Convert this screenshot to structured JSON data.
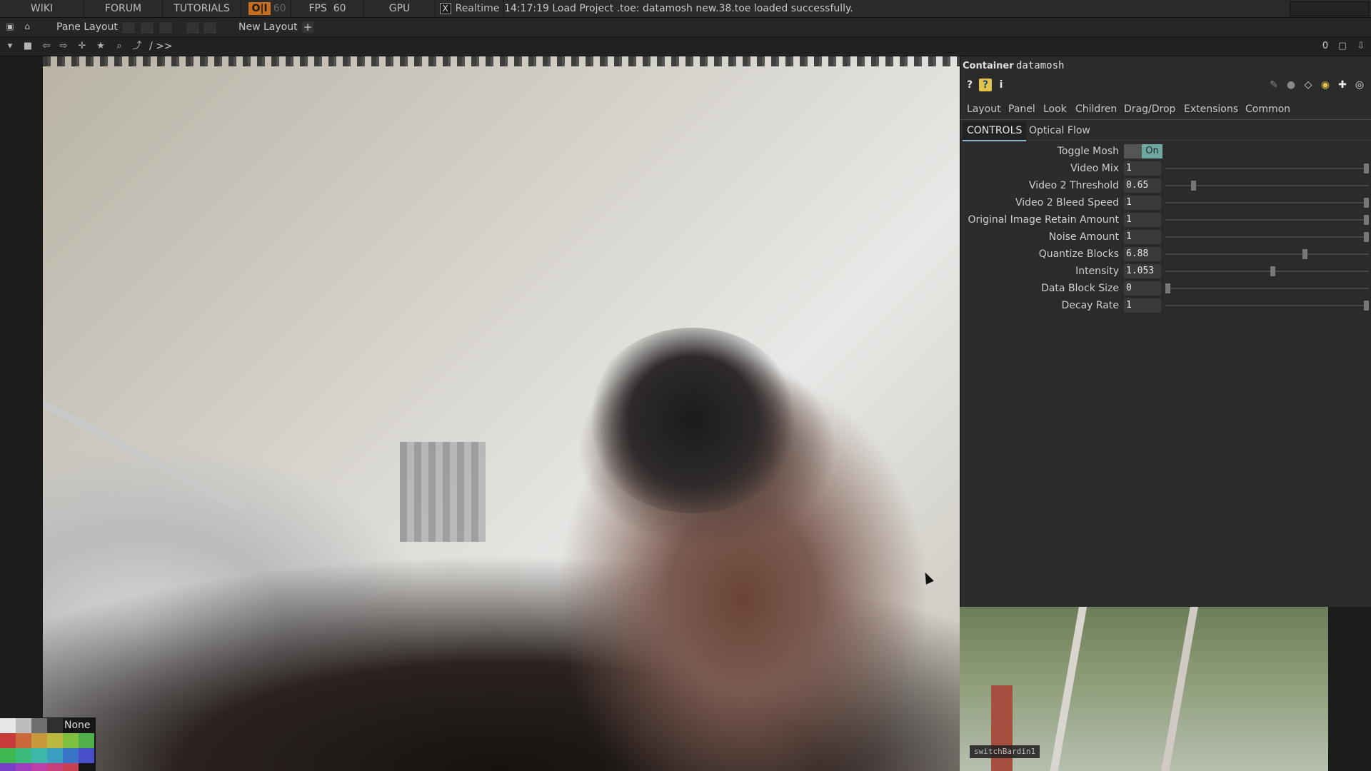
{
  "topbar": {
    "wiki": "WIKI",
    "forum": "FORUM",
    "tutorials": "TUTORIALS",
    "oi_badge": "O|I",
    "fps_target": "60",
    "fps_label": "FPS",
    "fps_value": "60",
    "gpu": "GPU",
    "realtime_check": "X",
    "realtime": "Realtime",
    "status_message": "14:17:19 Load Project .toe: datamosh new.38.toe loaded successfully."
  },
  "toolbar": {
    "pane_layout": "Pane Layout",
    "new_layout": "New Layout",
    "add_layout": "+"
  },
  "pathbar": {
    "path": "/ >>",
    "counter": "0"
  },
  "viewer": {
    "node_label": "switchBardin1"
  },
  "palette": {
    "none_label": "None"
  },
  "panel": {
    "op_type": "Container",
    "op_name": "datamosh",
    "icons": [
      "help-icon",
      "python-help-icon",
      "info-icon",
      "edit-icon",
      "comment-icon",
      "clone-icon",
      "python-icon",
      "add-icon",
      "target-icon"
    ],
    "tabs": [
      "Layout",
      "Panel",
      "Look",
      "Children",
      "Drag/Drop",
      "Extensions",
      "Common"
    ],
    "subtabs": [
      "CONTROLS",
      "Optical Flow"
    ],
    "active_subtab": "CONTROLS",
    "params": [
      {
        "label": "Toggle Mosh",
        "value": "On",
        "type": "toggle"
      },
      {
        "label": "Video Mix",
        "value": "1",
        "level": 1.0
      },
      {
        "label": "Video 2 Threshold",
        "value": "0.65",
        "level": 0.13
      },
      {
        "label": "Video 2 Bleed Speed",
        "value": "1",
        "level": 1.0
      },
      {
        "label": "Original Image Retain Amount",
        "value": "1",
        "level": 1.0
      },
      {
        "label": "Noise Amount",
        "value": "1",
        "level": 1.0
      },
      {
        "label": "Quantize Blocks",
        "value": "6.88",
        "level": 0.69
      },
      {
        "label": "Intensity",
        "value": "1.053",
        "level": 0.53
      },
      {
        "label": "Data Block Size",
        "value": "0",
        "level": 0.0
      },
      {
        "label": "Decay Rate",
        "value": "1",
        "level": 1.0
      }
    ]
  },
  "colors": {
    "accent_toggle": "#6ea8a1",
    "oi_badge": "#c86d1e",
    "panel_bg": "#2b2b2b"
  }
}
